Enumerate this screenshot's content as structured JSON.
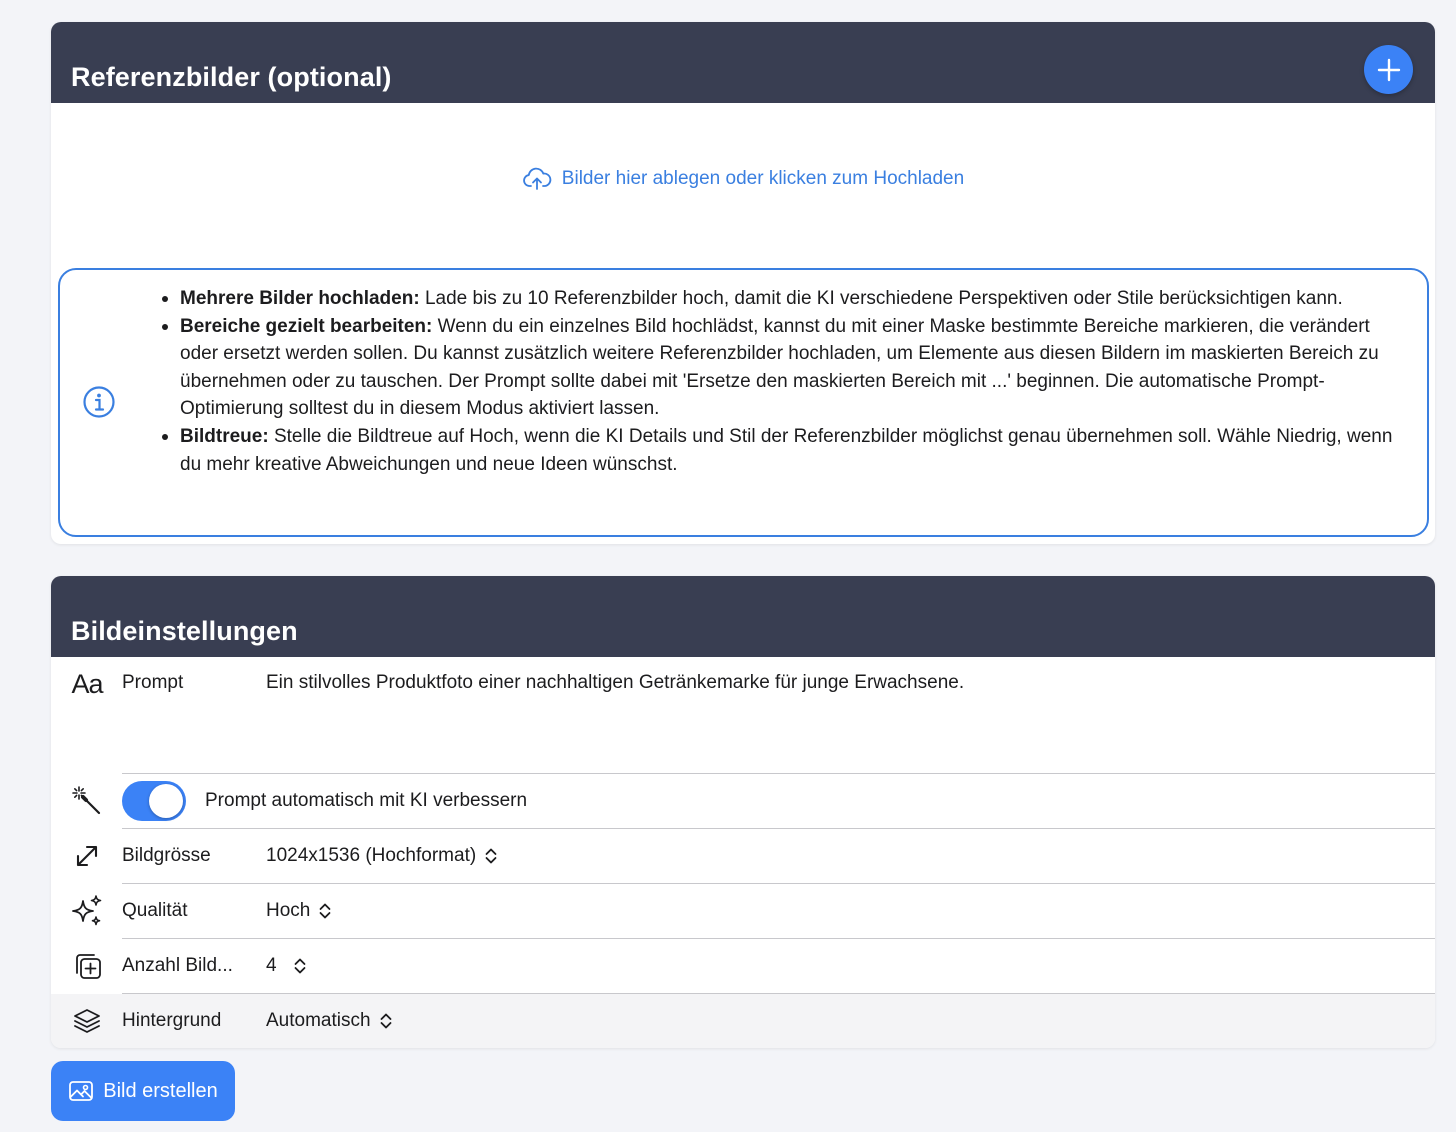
{
  "reference": {
    "title": "Referenzbilder (optional)",
    "dropzone_text": "Bilder hier ablegen oder klicken zum Hochladen",
    "info": [
      {
        "heading": "Mehrere Bilder hochladen:",
        "text": " Lade bis zu 10 Referenzbilder hoch, damit die KI verschiedene Perspektiven oder Stile berücksichtigen kann."
      },
      {
        "heading": "Bereiche gezielt bearbeiten:",
        "text": " Wenn du ein einzelnes Bild hochlädst, kannst du mit einer Maske bestimmte Bereiche markieren, die verändert oder ersetzt werden sollen. Du kannst zusätzlich weitere Referenzbilder hochladen, um Elemente aus diesen Bildern im maskierten Bereich zu übernehmen oder zu tauschen. Der Prompt sollte dabei mit 'Ersetze den maskierten Bereich mit ...' beginnen. Die automatische Prompt-Optimierung solltest du in diesem Modus aktiviert lassen."
      },
      {
        "heading": "Bildtreue:",
        "text": " Stelle die Bildtreue auf Hoch, wenn die KI Details und Stil der Referenzbilder möglichst genau übernehmen soll. Wähle Niedrig, wenn du mehr kreative Abweichungen und neue Ideen wünschst."
      }
    ]
  },
  "settings": {
    "title": "Bildeinstellungen",
    "prompt": {
      "label": "Prompt",
      "value": "Ein stilvolles Produktfoto einer nachhaltigen Getränkemarke für junge Erwachsene."
    },
    "enhance": {
      "label": "Prompt automatisch mit KI verbessern",
      "enabled": true
    },
    "size": {
      "label": "Bildgrösse",
      "value": "1024x1536 (Hochformat)"
    },
    "quality": {
      "label": "Qualität",
      "value": "Hoch"
    },
    "count": {
      "label": "Anzahl Bild...",
      "value": "4"
    },
    "background": {
      "label": "Hintergrund",
      "value": "Automatisch"
    }
  },
  "create_button": {
    "label": "Bild erstellen"
  },
  "icons": {
    "add": "plus-icon",
    "upload": "cloud-upload-icon",
    "info": "info-circle-icon",
    "prompt": "text-format-icon",
    "enhance": "magic-wand-icon",
    "size": "resize-arrows-icon",
    "quality": "sparkles-icon",
    "count": "add-copy-icon",
    "background": "layers-icon",
    "create": "image-icon",
    "chevron": "chevron-up-down-icon"
  },
  "colors": {
    "header": "#393e52",
    "accent": "#3b82f6",
    "link": "#3a7fe0",
    "background": "#f3f4f8"
  }
}
